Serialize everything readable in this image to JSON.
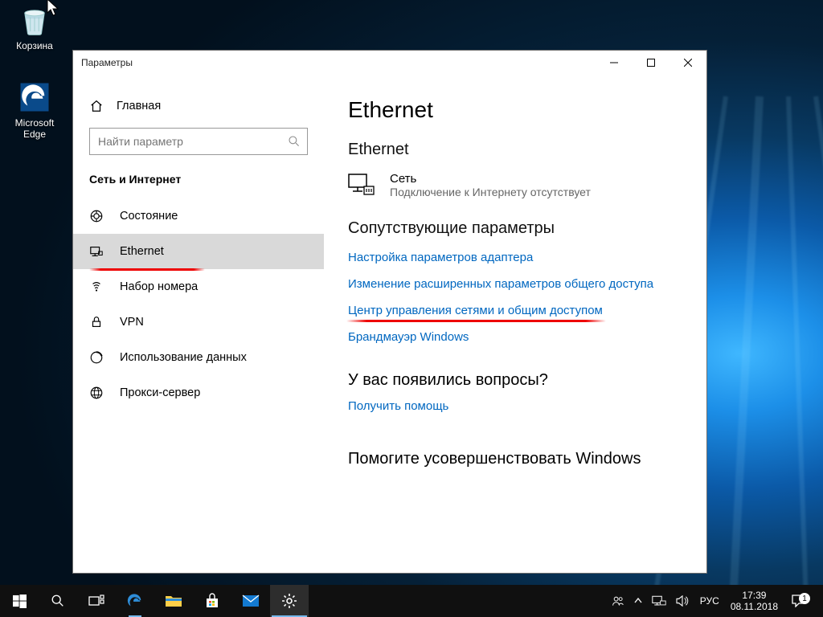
{
  "desktop": {
    "recycle_label": "Корзина",
    "edge_label": "Microsoft Edge"
  },
  "window": {
    "title": "Параметры"
  },
  "sidebar": {
    "home": "Главная",
    "search_placeholder": "Найти параметр",
    "section": "Сеть и Интернет",
    "items": [
      {
        "label": "Состояние"
      },
      {
        "label": "Ethernet"
      },
      {
        "label": "Набор номера"
      },
      {
        "label": "VPN"
      },
      {
        "label": "Использование данных"
      },
      {
        "label": "Прокси-сервер"
      }
    ]
  },
  "panel": {
    "heading": "Ethernet",
    "subheading": "Ethernet",
    "net_name": "Сеть",
    "net_status": "Подключение к Интернету отсутствует",
    "related_heading": "Сопутствующие параметры",
    "links": {
      "adapter": "Настройка параметров адаптера",
      "advanced_sharing": "Изменение расширенных параметров общего доступа",
      "network_center": "Центр управления сетями и общим доступом",
      "firewall": "Брандмауэр Windows"
    },
    "question_heading": "У вас появились вопросы?",
    "get_help": "Получить помощь",
    "feedback_heading": "Помогите усовершенствовать Windows"
  },
  "taskbar": {
    "lang": "РУС",
    "time": "17:39",
    "date": "08.11.2018",
    "notifications": "1"
  }
}
